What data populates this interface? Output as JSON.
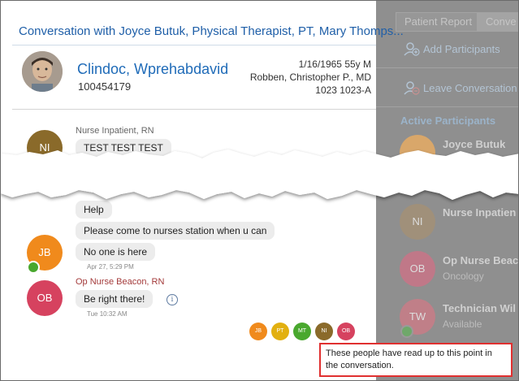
{
  "title": "Conversation with Joyce Butuk, Physical Therapist, PT, Mary Thomps...",
  "patient": {
    "name": "Clindoc, Wprehabdavid",
    "id": "100454179",
    "dob_age": "1/16/1965 55y M",
    "provider": "Robben, Christopher P., MD",
    "location": "1023 1023-A"
  },
  "messages": [
    {
      "initials": "NI",
      "sender": "Nurse Inpatient, RN",
      "bubbles": [
        "TEST TEST TEST"
      ],
      "color": "#8a6a2a"
    },
    {
      "initials": "JB",
      "bubbles": [
        "Help",
        "Please come to nurses station when u can",
        "No one is here"
      ],
      "timestamp": "Apr 27, 5:29 PM",
      "color": "#f08a1c"
    },
    {
      "initials": "OB",
      "sender": "Op Nurse Beacon, RN",
      "bubbles": [
        "Be right there!"
      ],
      "timestamp": "Tue 10:32 AM",
      "color": "#d6425f",
      "info_icon": "info-icon"
    }
  ],
  "readers": [
    {
      "initials": "JB",
      "color": "#f08a1c"
    },
    {
      "initials": "PT",
      "color": "#e2b010"
    },
    {
      "initials": "MT",
      "color": "#49a82e"
    },
    {
      "initials": "NI",
      "color": "#8a6a2a"
    },
    {
      "initials": "OB",
      "color": "#d6425f"
    }
  ],
  "callout": "These people have read up to this point in the conversation.",
  "right_panel": {
    "tabs": [
      "Patient Report",
      "Conve"
    ],
    "actions": [
      {
        "label": "Add Participants",
        "icon": "add-participant-icon"
      },
      {
        "label": "Leave Conversation",
        "icon": "leave-conversation-icon"
      }
    ],
    "section_title": "Active Participants",
    "participants": [
      {
        "initials": "",
        "name": "Joyce Butuk",
        "sub": "",
        "color": "#d9a76a"
      },
      {
        "initials": "NI",
        "name": "Nurse Inpatien",
        "sub": "",
        "color": "#a0907a"
      },
      {
        "initials": "OB",
        "name": "Op Nurse Beac",
        "sub": "Oncology",
        "color": "#c07888"
      },
      {
        "initials": "TW",
        "name": "Technician Wil",
        "sub": "Available",
        "color": "#c07f88"
      }
    ]
  }
}
